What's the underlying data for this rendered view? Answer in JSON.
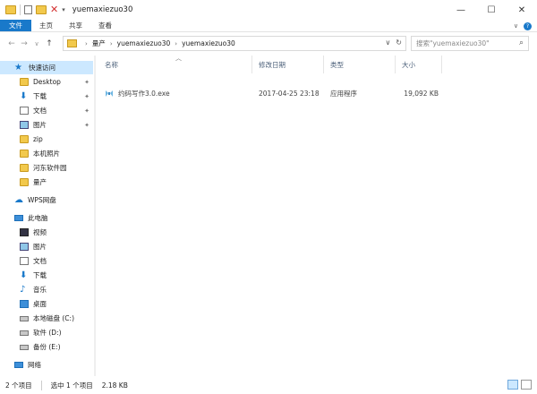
{
  "window": {
    "title": "yuemaxiezuo30",
    "minimize": "—",
    "maximize": "☐",
    "close": "✕"
  },
  "ribbon": {
    "tabs": [
      "文件",
      "主页",
      "共享",
      "查看"
    ],
    "expand": "∨",
    "help": "?"
  },
  "address": {
    "crumbs": [
      "量产",
      "yuemaxiezuo30",
      "yuemaxiezuo30"
    ],
    "dropdown": "∨",
    "refresh": "↻"
  },
  "search": {
    "placeholder": "搜索\"yuemaxiezuo30\""
  },
  "nav": {
    "quick_access": "快速访问",
    "items": [
      {
        "label": "Desktop",
        "icon": "desktop-folder-icon",
        "pinned": true
      },
      {
        "label": "下载",
        "icon": "download-icon",
        "pinned": true
      },
      {
        "label": "文档",
        "icon": "document-icon",
        "pinned": true
      },
      {
        "label": "图片",
        "icon": "pictures-icon",
        "pinned": true
      },
      {
        "label": "zip",
        "icon": "folder-icon",
        "pinned": false
      },
      {
        "label": "本机照片",
        "icon": "folder-icon",
        "pinned": false
      },
      {
        "label": "河东软件园",
        "icon": "folder-icon",
        "pinned": false
      },
      {
        "label": "量产",
        "icon": "folder-icon",
        "pinned": false
      }
    ],
    "wps": "WPS网盘",
    "this_pc": "此电脑",
    "pc_items": [
      {
        "label": "视频",
        "icon": "video-icon"
      },
      {
        "label": "图片",
        "icon": "pictures-icon"
      },
      {
        "label": "文档",
        "icon": "document-icon"
      },
      {
        "label": "下载",
        "icon": "download-icon"
      },
      {
        "label": "音乐",
        "icon": "music-icon"
      },
      {
        "label": "桌面",
        "icon": "desktop-icon"
      },
      {
        "label": "本地磁盘 (C:)",
        "icon": "drive-icon"
      },
      {
        "label": "软件 (D:)",
        "icon": "drive-icon"
      },
      {
        "label": "备份 (E:)",
        "icon": "drive-icon"
      }
    ],
    "network": "网络"
  },
  "columns": [
    "名称",
    "修改日期",
    "类型",
    "大小"
  ],
  "files": [
    {
      "name": "约码写作3.0.exe",
      "date": "2017-04-25 23:18",
      "type": "应用程序",
      "size": "19,092 KB"
    }
  ],
  "status": {
    "count": "2 个项目",
    "selected": "选中 1 个项目",
    "size": "2.18 KB"
  },
  "colors": {
    "accent": "#1979ca",
    "selection": "#cce8ff",
    "folder": "#f2c94c"
  }
}
